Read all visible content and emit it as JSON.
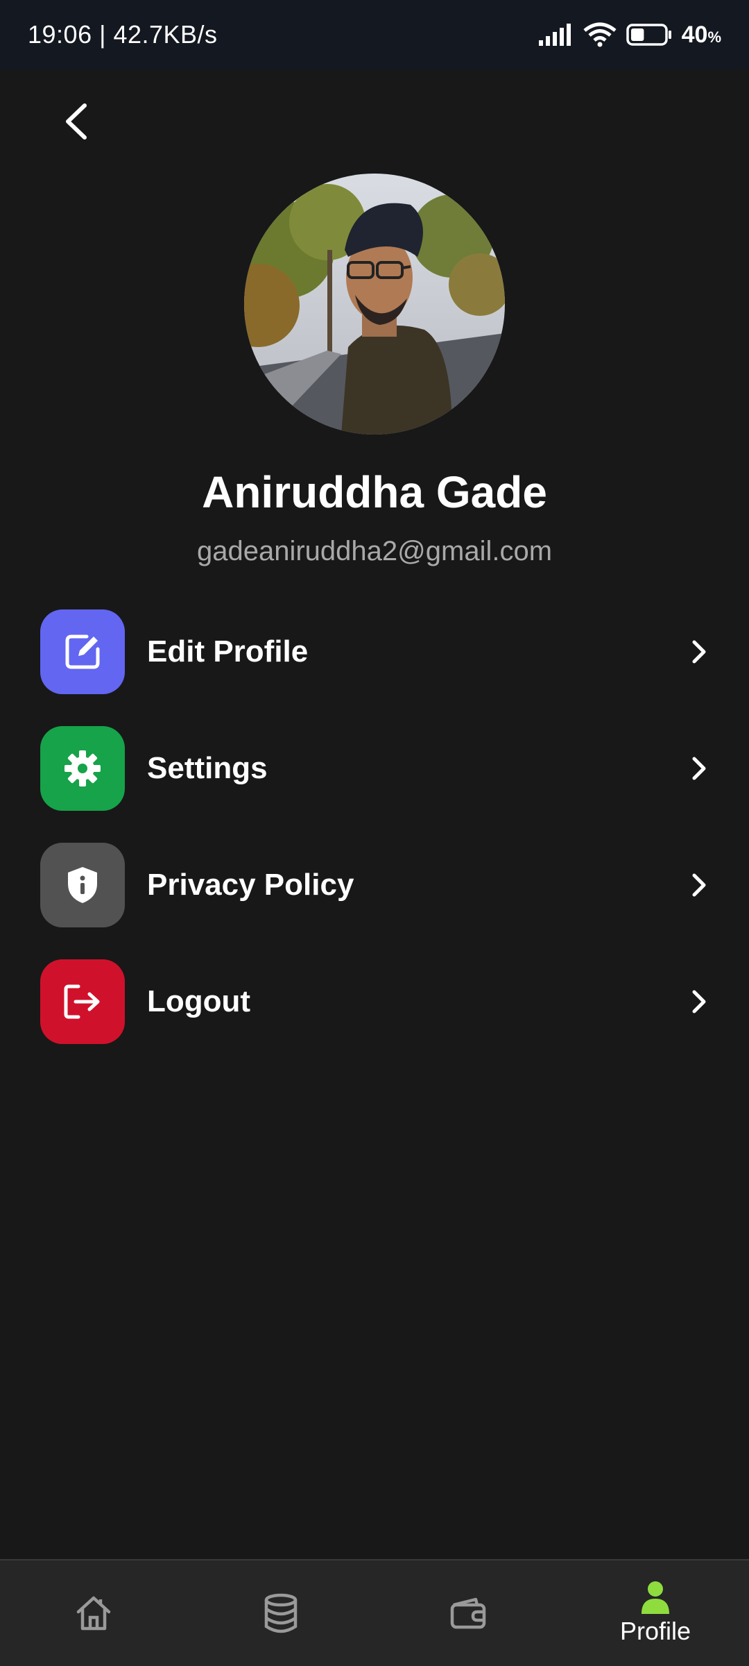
{
  "status_bar": {
    "time_speed": "19:06 | 42.7KB/s",
    "battery_pct": "40",
    "battery_unit": "%",
    "battery_level": 0.4
  },
  "profile": {
    "name": "Aniruddha Gade",
    "email": "gadeaniruddha2@gmail.com"
  },
  "menu": {
    "items": [
      {
        "label": "Edit Profile",
        "icon": "edit-icon",
        "color": "#6366f1"
      },
      {
        "label": "Settings",
        "icon": "gear-icon",
        "color": "#16a34a"
      },
      {
        "label": "Privacy Policy",
        "icon": "shield-icon",
        "color": "#525252"
      },
      {
        "label": "Logout",
        "icon": "logout-icon",
        "color": "#d0112b"
      }
    ]
  },
  "bottom_nav": {
    "items": [
      {
        "icon": "home-icon",
        "label": ""
      },
      {
        "icon": "database-icon",
        "label": ""
      },
      {
        "icon": "wallet-icon",
        "label": ""
      },
      {
        "icon": "profile-icon",
        "label": "Profile",
        "active": true
      }
    ],
    "active_color": "#8fdc3f"
  }
}
